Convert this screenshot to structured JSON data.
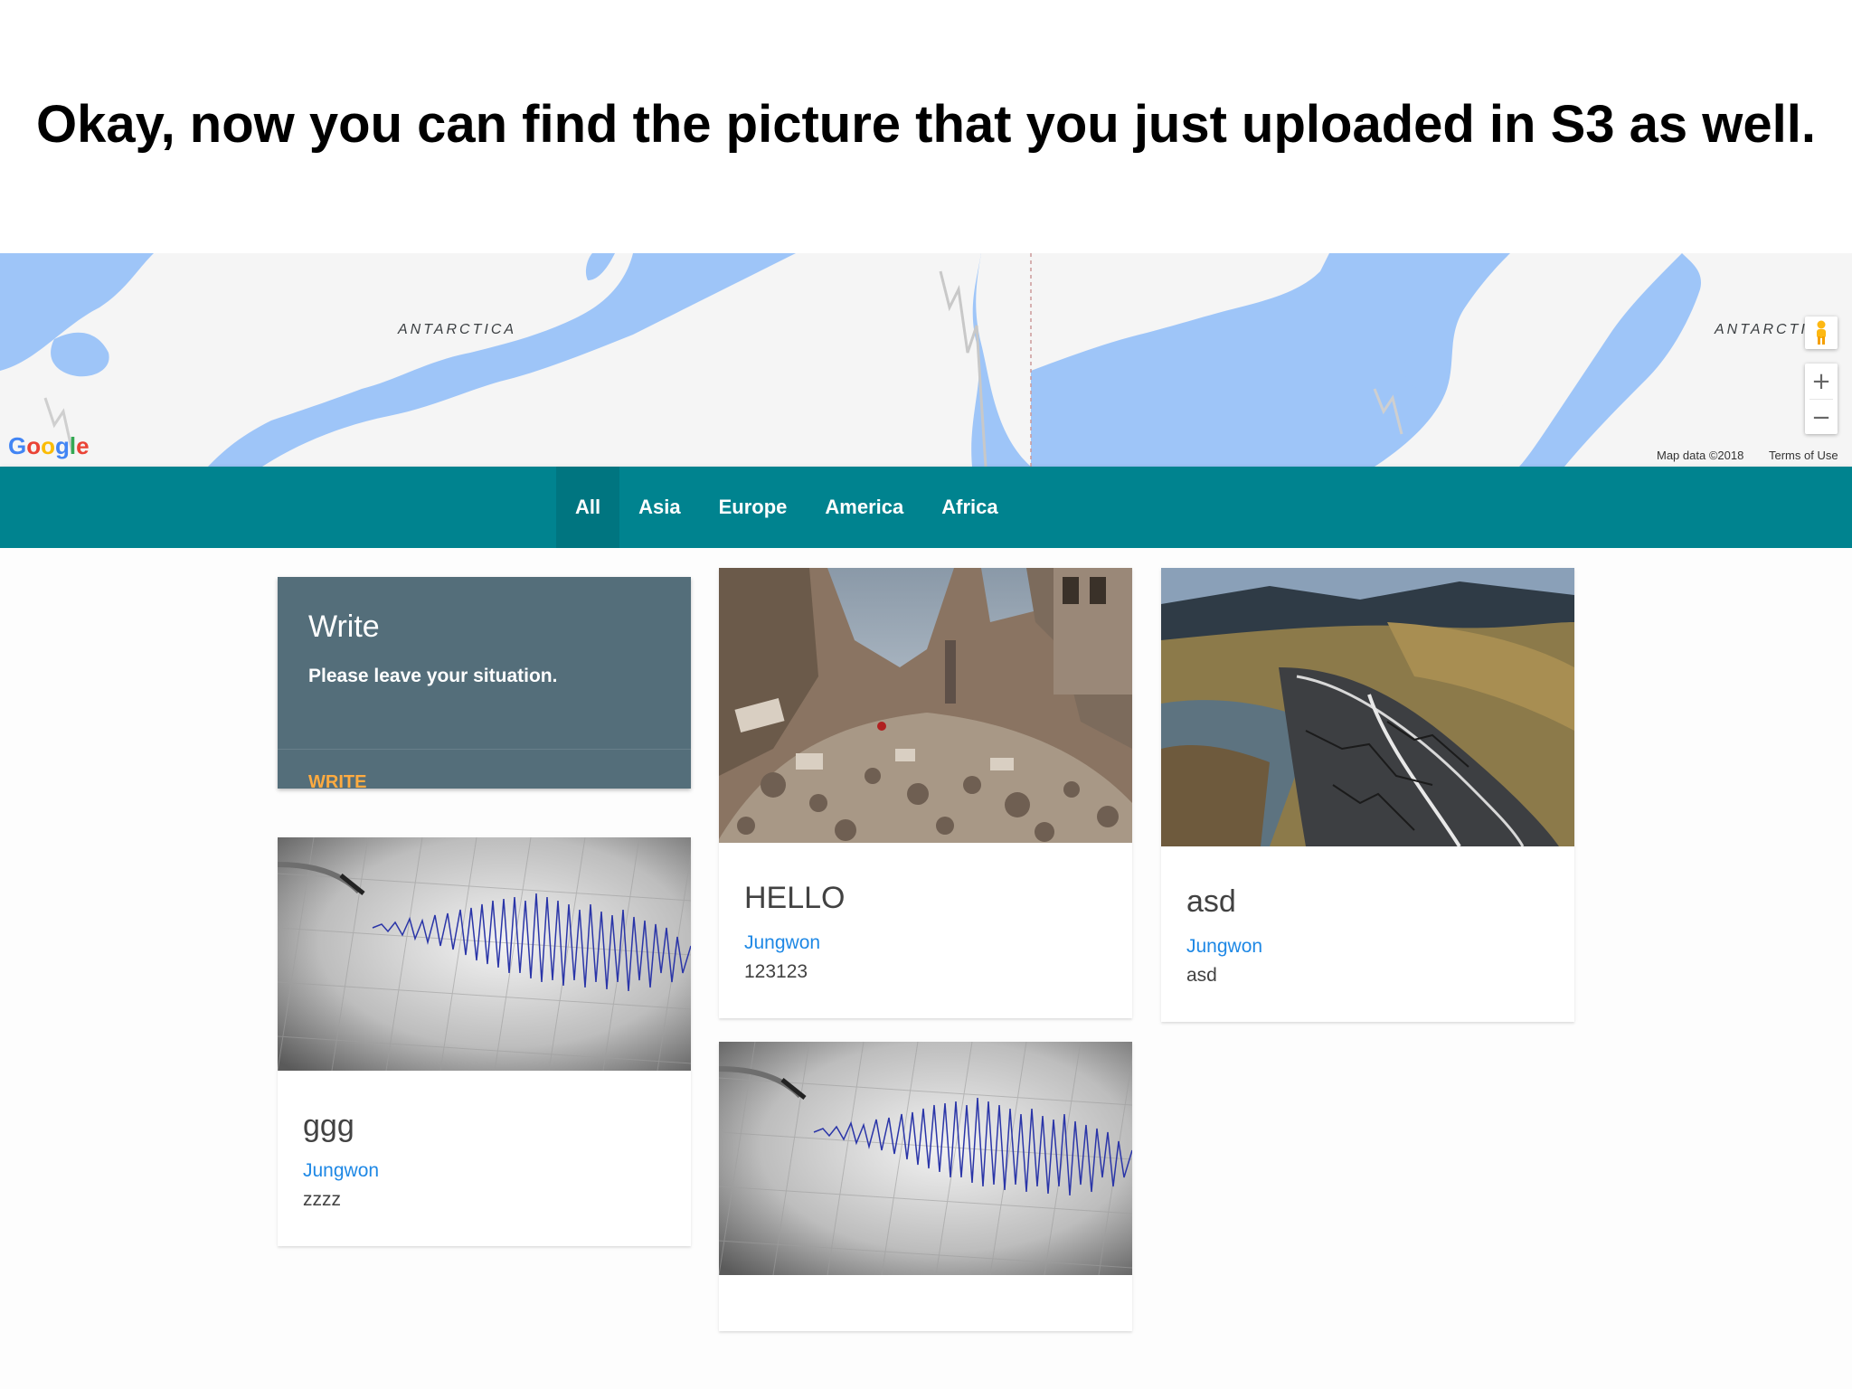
{
  "slide": {
    "heading": "Okay, now you can find the picture that you just uploaded in S3 as well."
  },
  "map": {
    "labels": [
      "ANTARCTICA",
      "ANTARCTI"
    ],
    "logo": [
      "G",
      "o",
      "o",
      "g",
      "l",
      "e"
    ],
    "logo_colors": [
      "#4285f4",
      "#ea4335",
      "#fbbc05",
      "#4285f4",
      "#34a853",
      "#ea4335"
    ],
    "map_data": "Map data ©2018",
    "terms": "Terms of Use",
    "zoom_in": "+",
    "zoom_out": "−",
    "pegman_icon": "pegman-icon",
    "water_color": "#9ec5f8",
    "land_color": "#f5f5f5"
  },
  "nav": {
    "items": [
      "All",
      "Asia",
      "Europe",
      "America",
      "Africa"
    ],
    "active": "All",
    "color": "#00838f"
  },
  "write_card": {
    "title": "Write",
    "subtitle": "Please leave your situation.",
    "action": "WRITE"
  },
  "posts": [
    {
      "title": "ggg",
      "author": "Jungwon",
      "text": "zzzz",
      "image": "seismograph"
    },
    {
      "title": "HELLO",
      "author": "Jungwon",
      "text": "123123",
      "image": "rubble"
    },
    {
      "title": "asd",
      "author": "Jungwon",
      "text": "asd",
      "image": "cracked-road"
    },
    {
      "title": "",
      "author": "",
      "text": "",
      "image": "seismograph"
    }
  ]
}
